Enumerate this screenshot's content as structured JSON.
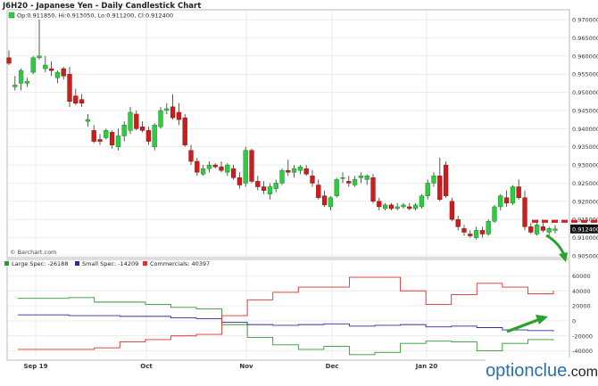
{
  "header": {
    "title": "J6H20 - Japanese Yen - Daily Candlestick Chart",
    "ohlc_label": "Op:0.911850, Hi:0.913050, Lo:0.911200, Cl:0.912400",
    "credit": "© Barchart.com"
  },
  "watermark": {
    "brand": "optionclue",
    "suffix": ".com"
  },
  "colors": {
    "up": "#2ecc40",
    "down": "#cc1e1e",
    "large_spec": "#2e9a2e",
    "small_spec": "#2d2d9e",
    "commercials": "#e03030",
    "grid": "#e3e3e3",
    "annotation_red": "#d32020",
    "annotation_green": "#2aa12a"
  },
  "chart_data": [
    {
      "type": "candlestick",
      "title": "J6H20 - Japanese Yen - Daily Candlestick Chart",
      "x_ticks": [
        "Sep 19",
        "Oct",
        "Nov",
        "Dec",
        "Jan 20"
      ],
      "ylim": [
        0.9045,
        0.9705
      ],
      "y_ticks": [
        "0.970000",
        "0.965000",
        "0.960000",
        "0.955000",
        "0.950000",
        "0.945000",
        "0.940000",
        "0.935000",
        "0.930000",
        "0.925000",
        "0.920000",
        "0.915000",
        "0.910000",
        "0.905000"
      ],
      "last_value": "0.912400",
      "grid": true,
      "candles": [
        [
          0.9595,
          0.9615,
          0.9575,
          0.958
        ],
        [
          0.9515,
          0.9545,
          0.9505,
          0.952
        ],
        [
          0.9525,
          0.9565,
          0.9505,
          0.956
        ],
        [
          0.9525,
          0.954,
          0.9515,
          0.953
        ],
        [
          0.9555,
          0.96,
          0.955,
          0.9595
        ],
        [
          0.9595,
          0.97,
          0.959,
          0.96
        ],
        [
          0.9565,
          0.96,
          0.9555,
          0.9575
        ],
        [
          0.9565,
          0.9585,
          0.9545,
          0.956
        ],
        [
          0.954,
          0.956,
          0.9525,
          0.9555
        ],
        [
          0.9565,
          0.957,
          0.9535,
          0.9545
        ],
        [
          0.955,
          0.957,
          0.946,
          0.9475
        ],
        [
          0.949,
          0.951,
          0.9465,
          0.947
        ],
        [
          0.948,
          0.9495,
          0.946,
          0.947
        ],
        [
          0.942,
          0.944,
          0.9405,
          0.9425
        ],
        [
          0.9395,
          0.941,
          0.936,
          0.9365
        ],
        [
          0.937,
          0.9385,
          0.9355,
          0.9365
        ],
        [
          0.9375,
          0.94,
          0.937,
          0.9395
        ],
        [
          0.939,
          0.9395,
          0.9345,
          0.9355
        ],
        [
          0.935,
          0.94,
          0.934,
          0.938
        ],
        [
          0.938,
          0.942,
          0.9365,
          0.941
        ],
        [
          0.9395,
          0.946,
          0.9385,
          0.9445
        ],
        [
          0.944,
          0.945,
          0.9395,
          0.94
        ],
        [
          0.9405,
          0.942,
          0.939,
          0.9395
        ],
        [
          0.9395,
          0.9405,
          0.9355,
          0.9365
        ],
        [
          0.935,
          0.9415,
          0.934,
          0.941
        ],
        [
          0.9405,
          0.946,
          0.94,
          0.945
        ],
        [
          0.945,
          0.947,
          0.944,
          0.9455
        ],
        [
          0.946,
          0.9495,
          0.9425,
          0.943
        ],
        [
          0.9445,
          0.947,
          0.941,
          0.9425
        ],
        [
          0.943,
          0.944,
          0.935,
          0.9355
        ],
        [
          0.934,
          0.9355,
          0.93,
          0.931
        ],
        [
          0.931,
          0.932,
          0.927,
          0.928
        ],
        [
          0.9275,
          0.93,
          0.927,
          0.929
        ],
        [
          0.929,
          0.931,
          0.928,
          0.93
        ],
        [
          0.93,
          0.9305,
          0.929,
          0.9295
        ],
        [
          0.9295,
          0.931,
          0.928,
          0.9285
        ],
        [
          0.928,
          0.9305,
          0.927,
          0.93
        ],
        [
          0.929,
          0.93,
          0.926,
          0.9265
        ],
        [
          0.9265,
          0.928,
          0.9235,
          0.9245
        ],
        [
          0.925,
          0.935,
          0.924,
          0.934
        ],
        [
          0.934,
          0.9345,
          0.925,
          0.9255
        ],
        [
          0.9255,
          0.927,
          0.923,
          0.924
        ],
        [
          0.924,
          0.9255,
          0.922,
          0.923
        ],
        [
          0.922,
          0.925,
          0.9205,
          0.924
        ],
        [
          0.9235,
          0.926,
          0.9225,
          0.925
        ],
        [
          0.925,
          0.929,
          0.9245,
          0.9285
        ],
        [
          0.9285,
          0.9315,
          0.927,
          0.928
        ],
        [
          0.928,
          0.93,
          0.9265,
          0.929
        ],
        [
          0.9285,
          0.93,
          0.9275,
          0.9295
        ],
        [
          0.929,
          0.93,
          0.927,
          0.9275
        ],
        [
          0.927,
          0.9285,
          0.924,
          0.925
        ],
        [
          0.9245,
          0.926,
          0.9205,
          0.921
        ],
        [
          0.9215,
          0.923,
          0.9185,
          0.919
        ],
        [
          0.9185,
          0.9215,
          0.9175,
          0.921
        ],
        [
          0.9215,
          0.9265,
          0.921,
          0.926
        ],
        [
          0.9265,
          0.928,
          0.925,
          0.9265
        ],
        [
          0.9255,
          0.927,
          0.924,
          0.925
        ],
        [
          0.9245,
          0.927,
          0.924,
          0.926
        ],
        [
          0.9265,
          0.928,
          0.925,
          0.927
        ],
        [
          0.926,
          0.9275,
          0.9245,
          0.927
        ],
        [
          0.9265,
          0.9275,
          0.9195,
          0.92
        ],
        [
          0.92,
          0.921,
          0.9175,
          0.9185
        ],
        [
          0.918,
          0.9195,
          0.9175,
          0.919
        ],
        [
          0.919,
          0.9195,
          0.9175,
          0.918
        ],
        [
          0.918,
          0.9195,
          0.9175,
          0.9185
        ],
        [
          0.9185,
          0.9195,
          0.918,
          0.919
        ],
        [
          0.9185,
          0.9195,
          0.9175,
          0.918
        ],
        [
          0.918,
          0.9195,
          0.9175,
          0.919
        ],
        [
          0.9185,
          0.922,
          0.918,
          0.9215
        ],
        [
          0.9215,
          0.926,
          0.9205,
          0.925
        ],
        [
          0.925,
          0.928,
          0.924,
          0.927
        ],
        [
          0.927,
          0.932,
          0.92,
          0.9205
        ],
        [
          0.93,
          0.931,
          0.921,
          0.9215
        ],
        [
          0.92,
          0.921,
          0.9145,
          0.915
        ],
        [
          0.915,
          0.916,
          0.912,
          0.913
        ],
        [
          0.9125,
          0.9135,
          0.9105,
          0.9115
        ],
        [
          0.911,
          0.912,
          0.91,
          0.9105
        ],
        [
          0.91,
          0.913,
          0.9095,
          0.912
        ],
        [
          0.912,
          0.913,
          0.91,
          0.911
        ],
        [
          0.911,
          0.915,
          0.9105,
          0.9145
        ],
        [
          0.9145,
          0.919,
          0.914,
          0.9185
        ],
        [
          0.9185,
          0.922,
          0.9175,
          0.9215
        ],
        [
          0.921,
          0.923,
          0.9185,
          0.9195
        ],
        [
          0.9195,
          0.9245,
          0.919,
          0.924
        ],
        [
          0.924,
          0.926,
          0.9205,
          0.921
        ],
        [
          0.921,
          0.923,
          0.912,
          0.913
        ],
        [
          0.913,
          0.914,
          0.911,
          0.9115
        ],
        [
          0.911,
          0.914,
          0.9105,
          0.9135
        ],
        [
          0.913,
          0.914,
          0.9115,
          0.912
        ],
        [
          0.9115,
          0.913,
          0.91,
          0.9125
        ],
        [
          0.912,
          0.9135,
          0.9112,
          0.9124
        ]
      ]
    },
    {
      "type": "line",
      "legend": [
        {
          "name": "Large Spec: -26188"
        },
        {
          "name": "Small Spec: -14209"
        },
        {
          "name": "Commercials: 40397"
        }
      ],
      "x_ticks": [
        "Sep 19",
        "Oct",
        "Nov",
        "Dec",
        "Jan 20"
      ],
      "ylim": [
        -50000,
        70000
      ],
      "y_ticks": [
        "60000",
        "40000",
        "20000",
        "0",
        "-20000",
        "-40000"
      ],
      "series": [
        {
          "name": "Large Spec",
          "values": [
            30000,
            30000,
            31000,
            25000,
            25000,
            22000,
            18000,
            16000,
            -5000,
            -22000,
            -32000,
            -38000,
            -34000,
            -45000,
            -42000,
            -30000,
            -27000,
            -28000,
            -40000,
            -30000,
            -25000,
            -26000
          ]
        },
        {
          "name": "Small Spec",
          "values": [
            8000,
            8000,
            7000,
            7000,
            6000,
            6000,
            4000,
            3000,
            -2000,
            -5000,
            -6000,
            -5000,
            -4000,
            -7000,
            -6000,
            -5000,
            -8000,
            -7000,
            -9000,
            -12000,
            -13000,
            -14209
          ]
        },
        {
          "name": "Commercials",
          "values": [
            -38000,
            -38000,
            -38000,
            -36000,
            -28000,
            -25000,
            -20000,
            -18000,
            7000,
            28000,
            38000,
            45000,
            45000,
            58000,
            58000,
            40000,
            22000,
            35000,
            50000,
            45000,
            36000,
            40397
          ]
        }
      ]
    }
  ]
}
